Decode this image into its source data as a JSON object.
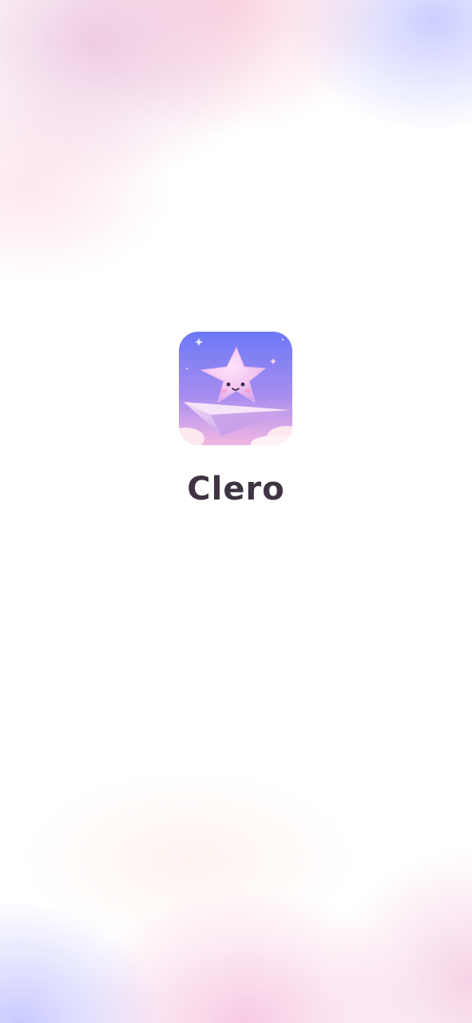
{
  "app": {
    "name": "Clero",
    "icon": "star-on-paper-plane-icon"
  },
  "colors": {
    "title_text": "#3f3442",
    "icon_sky_top": "#6f79f6",
    "icon_sky_bottom": "#e7a6e8",
    "star": "#f4c7f2",
    "paper_plane": "#c8a0f0",
    "background": "#ffffff"
  }
}
